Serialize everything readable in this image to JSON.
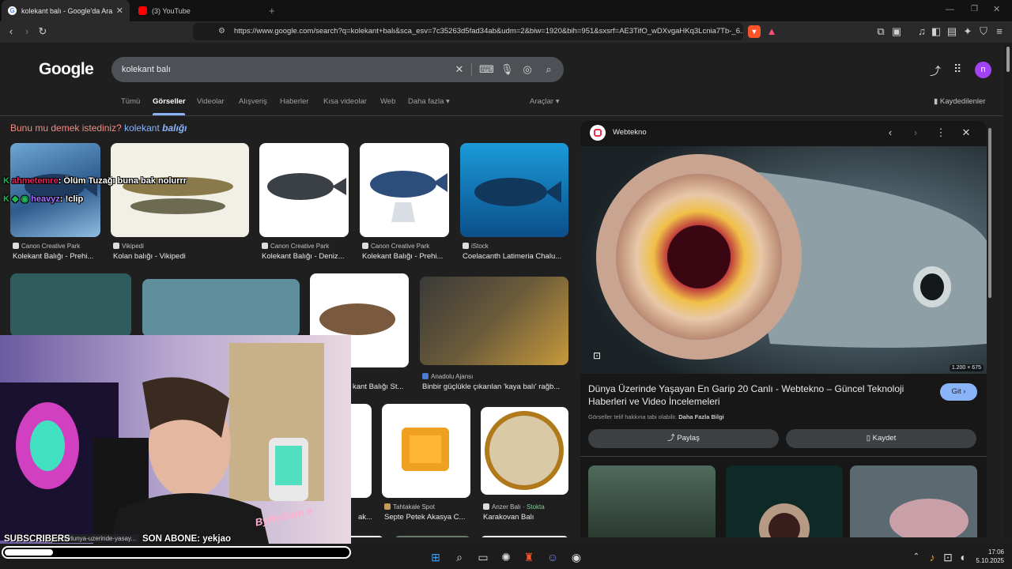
{
  "browser": {
    "tabs": [
      {
        "title": "kolekant balı - Google'da Ara",
        "active": true,
        "icon": "google-icon"
      },
      {
        "title": "(3) YouTube",
        "active": false,
        "icon": "youtube-icon"
      }
    ],
    "new_tab": "+",
    "url": "https://www.google.com/search?q=kolekant+balı&sca_esv=7c35263d5fad34ab&udm=2&biw=1920&bih=951&sxsrf=AE3TifO_wDXvgaHKq3Lcnia7Tb-_6..."
  },
  "google": {
    "logo": "Google",
    "query": "kolekant balı",
    "nav": [
      "Tümü",
      "Görseller",
      "Videolar",
      "Alışveriş",
      "Haberler",
      "Kısa videolar",
      "Web",
      "Daha fazla ▾"
    ],
    "tools": "Araçlar ▾",
    "saved": "Kaydedilenler",
    "avatar": "n",
    "did_you_mean_prefix": "Bunu mu demek istediniz?",
    "did_you_mean_word": "kolekant",
    "did_you_mean_bold": "balığı",
    "results_row1": [
      {
        "source": "Canon Creative Park",
        "title": "Kolekant Balığı - Prehi..."
      },
      {
        "source": "Vikipedi",
        "title": "Kolan balığı - Vikipedi"
      },
      {
        "source": "Canon Creative Park",
        "title": "Kolekant Balığı - Deniz..."
      },
      {
        "source": "Canon Creative Park",
        "title": "Kolekant Balığı - Prehi..."
      },
      {
        "source": "iStock",
        "title": "Coelacanth Latimeria Chalu..."
      }
    ],
    "results_row2": [
      {
        "source": "",
        "title": "kant Balığı St..."
      },
      {
        "source": "Anadolu Ajansı",
        "title": "Binbir güçlükle çıkarılan 'kaya balı' rağb..."
      }
    ],
    "results_row3": [
      {
        "source": "",
        "title": "ak..."
      },
      {
        "source": "Tahtakale Spot",
        "title": "Septe Petek Akasya C..."
      },
      {
        "source": "Anzer Balı",
        "source_extra": "Stokta",
        "title": "Karakovan Balı"
      }
    ]
  },
  "panel": {
    "source": "Webtekno",
    "dimensions": "1.200 × 675",
    "title": "Dünya Üzerinde Yaşayan En Garip 20 Canlı - Webtekno – Güncel Teknoloji Haberleri ve Video İncelemeleri",
    "visit": "Git ›",
    "copyright": "Görseller telif hakkına tabi olabilir.",
    "more_info": "Daha Fazla Bilgi",
    "share": "Paylaş",
    "save": "Kaydet"
  },
  "stream": {
    "chat1_user": "ahmetemre",
    "chat1_text": ": Ölüm Tuzağı buna bak nolurrr",
    "chat2_user": "heavyz",
    "chat2_text": ": !clip",
    "subscribers": "SUBSCRIBERS",
    "son_abone": "SON ABONE: yekjao",
    "status_url": "com/dunya-uzerinde-yasay...",
    "watermark": "ByNoGame",
    "progress": 0.14
  },
  "taskbar": {
    "time": "17:06",
    "date": "5.10.2025"
  },
  "colors": {
    "accent": "#8ab4f8",
    "avatar_bg": "#a142f4",
    "did_you_mean": "#f28b82"
  }
}
